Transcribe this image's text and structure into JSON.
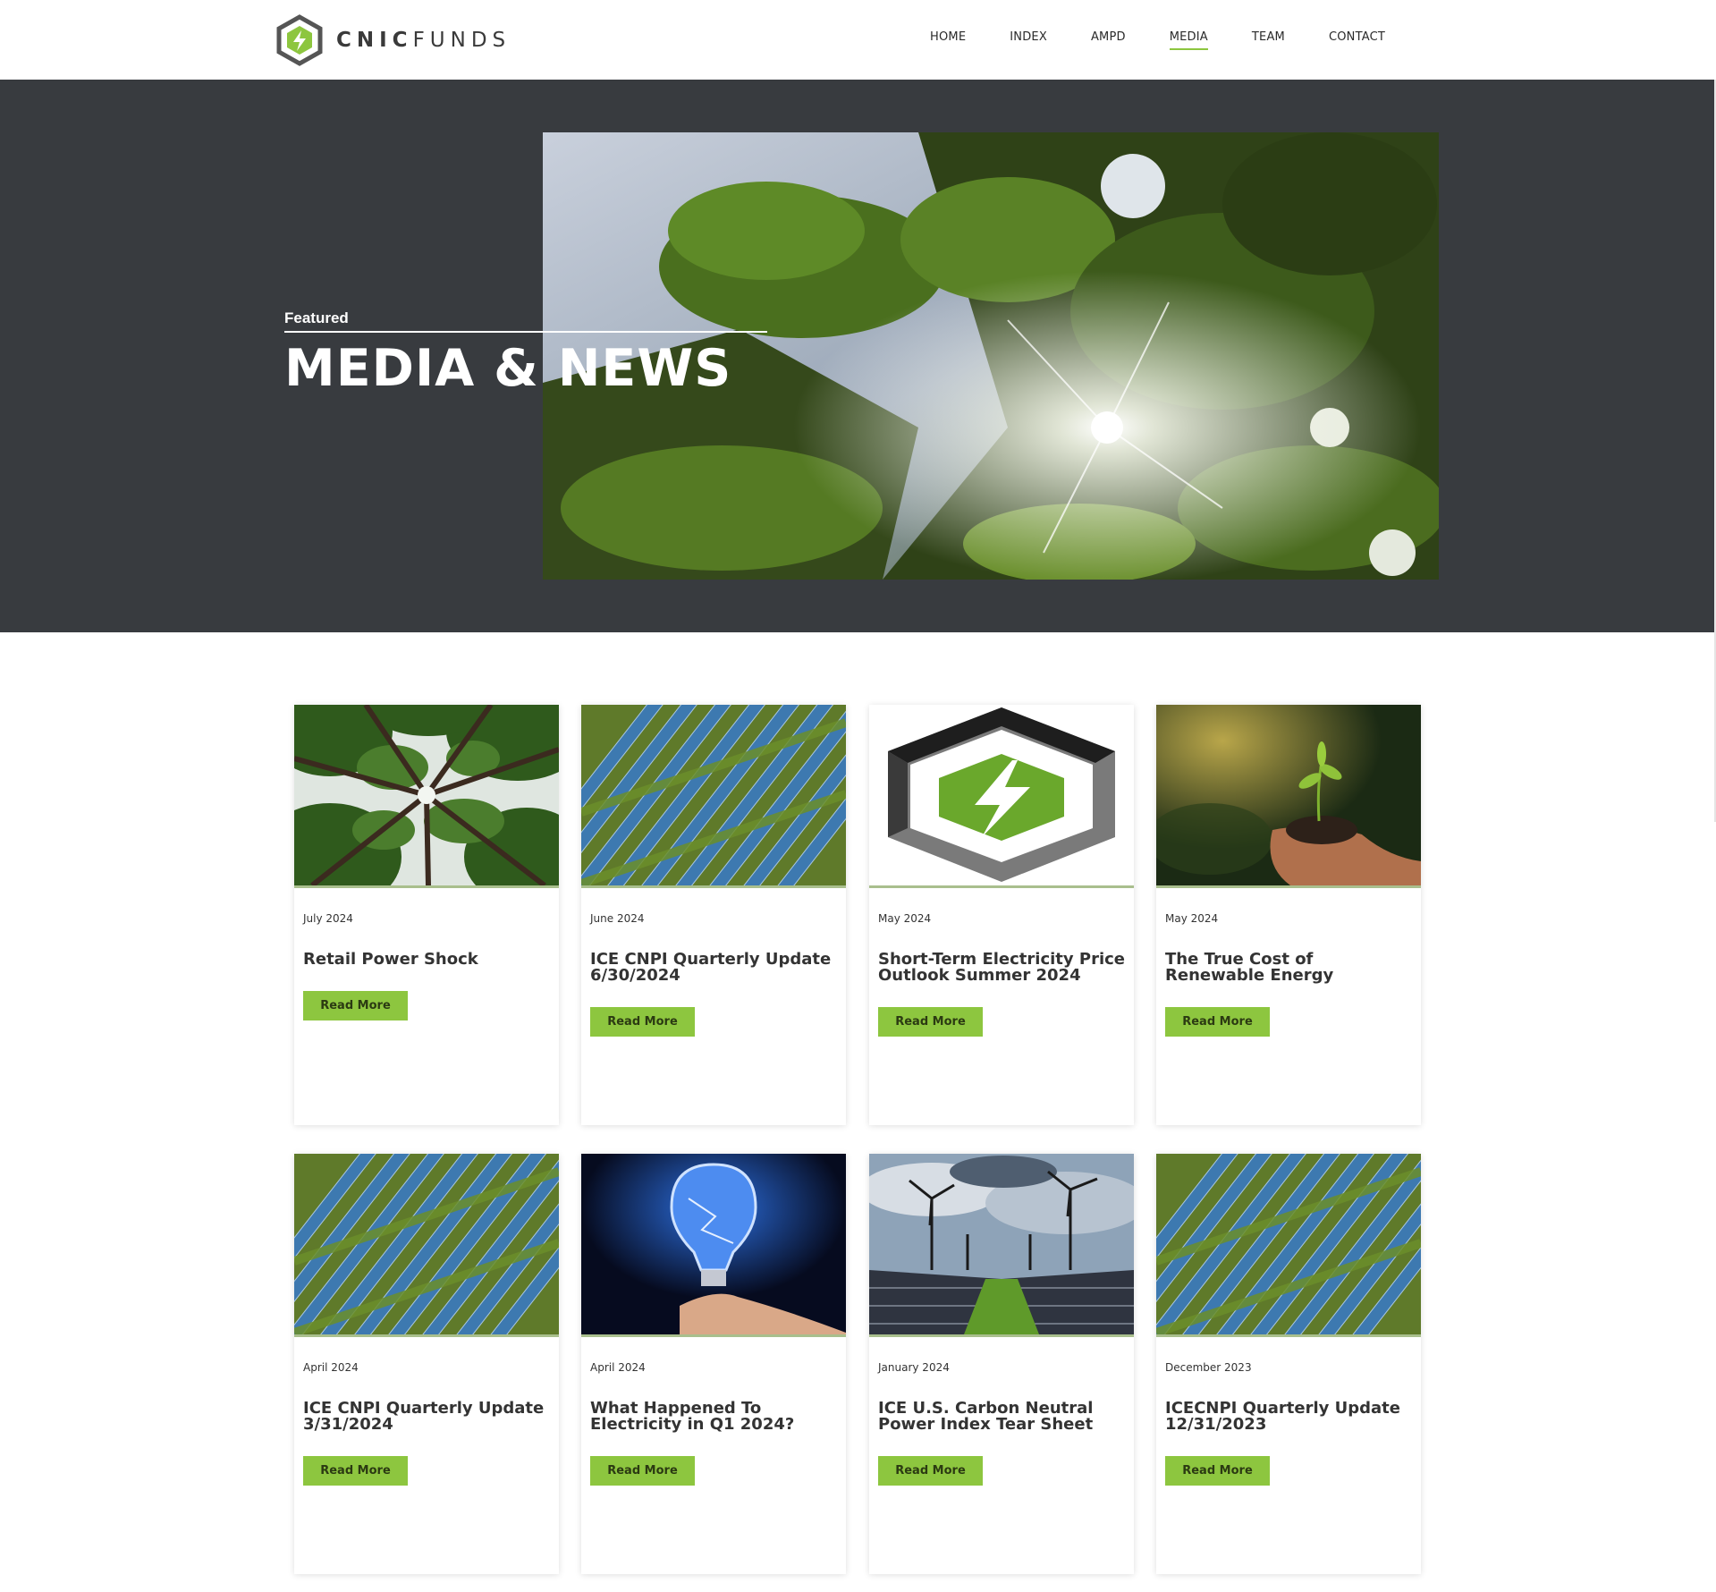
{
  "brand": {
    "name_bold": "CNIC",
    "name_light": "FUNDS",
    "accent": "#8dc63f",
    "dark": "#383b3f"
  },
  "nav": {
    "items": [
      {
        "label": "HOME"
      },
      {
        "label": "INDEX"
      },
      {
        "label": "AMPD"
      },
      {
        "label": "MEDIA",
        "active": true
      },
      {
        "label": "TEAM"
      },
      {
        "label": "CONTACT"
      }
    ]
  },
  "hero": {
    "eyebrow": "Featured",
    "title": "MEDIA & NEWS",
    "image": "sunlit-leaves-photo"
  },
  "cards": [
    {
      "date": "July 2024",
      "title": "Retail Power Shock",
      "button": "Read More",
      "image": "forest-canopy-photo"
    },
    {
      "date": "June 2024",
      "title": "ICE CNPI Quarterly Update 6/30/2024",
      "button": "Read More",
      "image": "solar-panels-aerial-photo"
    },
    {
      "date": "May 2024",
      "title": "Short-Term Electricity Price Outlook Summer 2024",
      "button": "Read More",
      "image": "cnic-hexagon-logo"
    },
    {
      "date": "May 2024",
      "title": "The True Cost of Renewable Energy",
      "button": "Read More",
      "image": "seedling-in-hands-photo"
    },
    {
      "date": "April 2024",
      "title": "ICE CNPI Quarterly Update 3/31/2024",
      "button": "Read More",
      "image": "solar-panels-aerial-photo"
    },
    {
      "date": "April 2024",
      "title": "What Happened To Electricity in Q1 2024?",
      "button": "Read More",
      "image": "electric-bulb-hand-photo"
    },
    {
      "date": "January 2024",
      "title": "ICE U.S. Carbon Neutral Power Index Tear Sheet",
      "button": "Read More",
      "image": "wind-turbines-solar-photo"
    },
    {
      "date": "December 2023",
      "title": "ICECNPI Quarterly Update 12/31/2023",
      "button": "Read More",
      "image": "solar-panels-aerial-photo"
    }
  ]
}
